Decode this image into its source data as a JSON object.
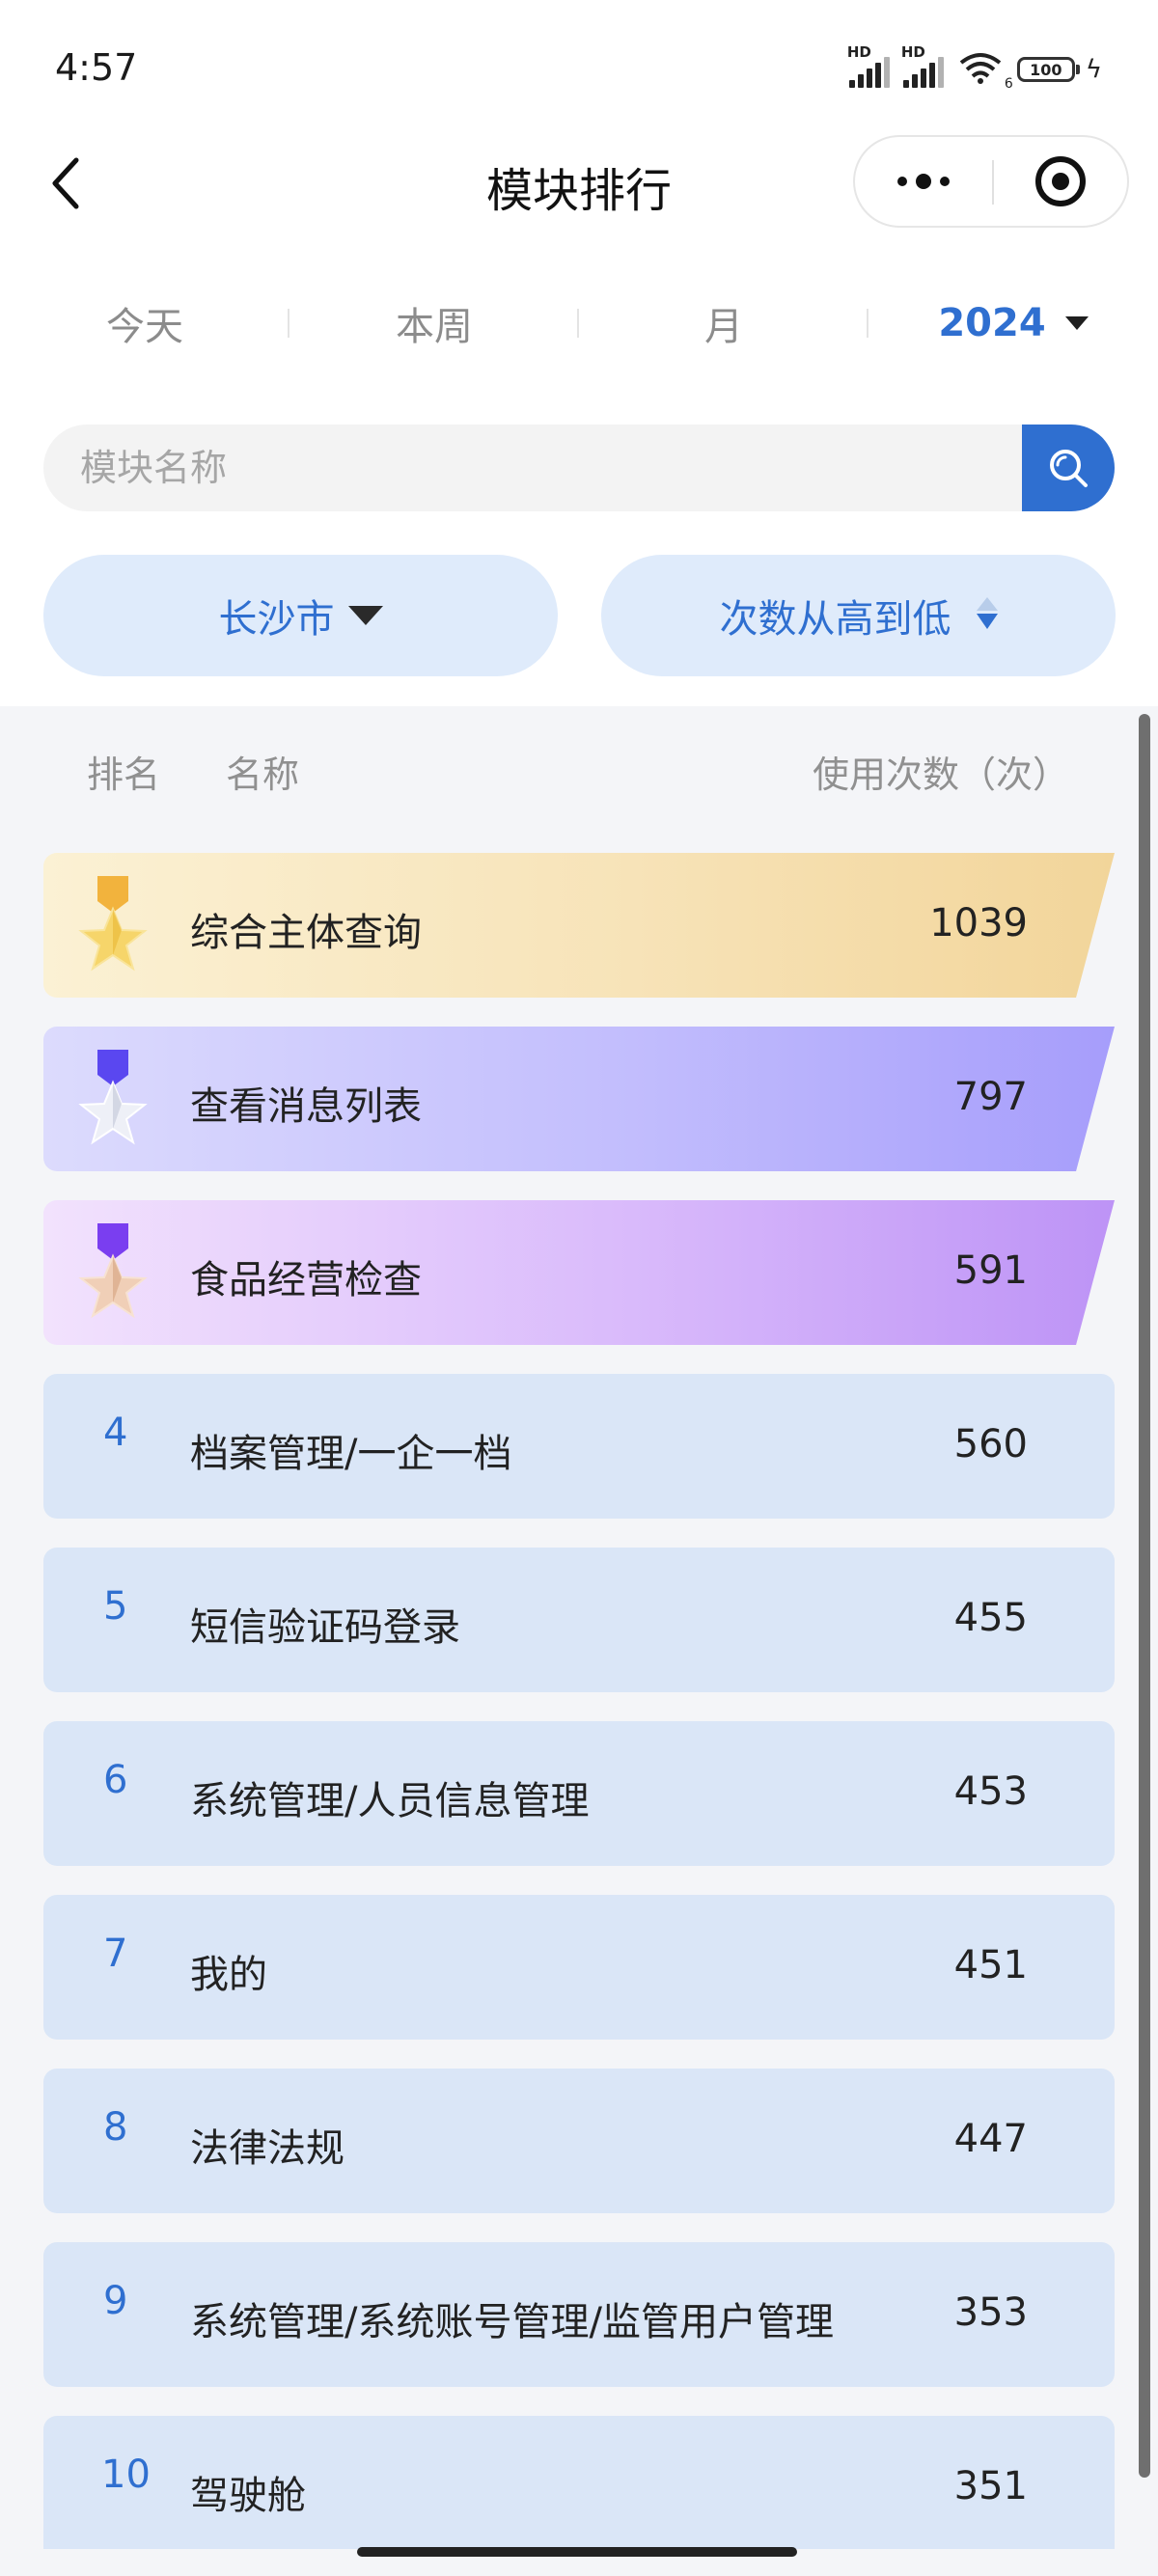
{
  "status_bar": {
    "time": "4:57",
    "signal_1_label": "HD",
    "signal_2_label": "HD",
    "wifi_badge": "6",
    "battery": "100"
  },
  "nav": {
    "title": "模块排行",
    "back_icon": "chevron-left-icon",
    "more_icon": "more-dots-icon",
    "close_icon": "target-close-icon"
  },
  "period_tabs": [
    {
      "label": "今天",
      "active": false
    },
    {
      "label": "本周",
      "active": false
    },
    {
      "label": "月",
      "active": false
    },
    {
      "label": "2024",
      "active": true
    }
  ],
  "search": {
    "placeholder": "模块名称",
    "value": "",
    "icon": "search-icon"
  },
  "filters": {
    "city": "长沙市",
    "sort": "次数从高到低"
  },
  "table": {
    "headers": {
      "rank": "排名",
      "name": "名称",
      "count": "使用次数（次）"
    },
    "rows": [
      {
        "rank": "1",
        "name": "综合主体查询",
        "count": "1039",
        "medal": "gold-medal-icon"
      },
      {
        "rank": "2",
        "name": "查看消息列表",
        "count": "797",
        "medal": "silver-medal-icon"
      },
      {
        "rank": "3",
        "name": "食品经营检查",
        "count": "591",
        "medal": "bronze-medal-icon"
      },
      {
        "rank": "4",
        "name": "档案管理/一企一档",
        "count": "560"
      },
      {
        "rank": "5",
        "name": "短信验证码登录",
        "count": "455"
      },
      {
        "rank": "6",
        "name": "系统管理/人员信息管理",
        "count": "453"
      },
      {
        "rank": "7",
        "name": "我的",
        "count": "451"
      },
      {
        "rank": "8",
        "name": "法律法规",
        "count": "447"
      },
      {
        "rank": "9",
        "name": "系统管理/系统账号管理/监管用户管理",
        "count": "353"
      },
      {
        "rank": "10",
        "name": "驾驶舱",
        "count": "351"
      }
    ]
  },
  "colors": {
    "accent": "#2f6fd0",
    "row_bg": "#dae6f7",
    "filter_bg": "#dfebfb",
    "panel_bg": "#f4f5f8"
  }
}
